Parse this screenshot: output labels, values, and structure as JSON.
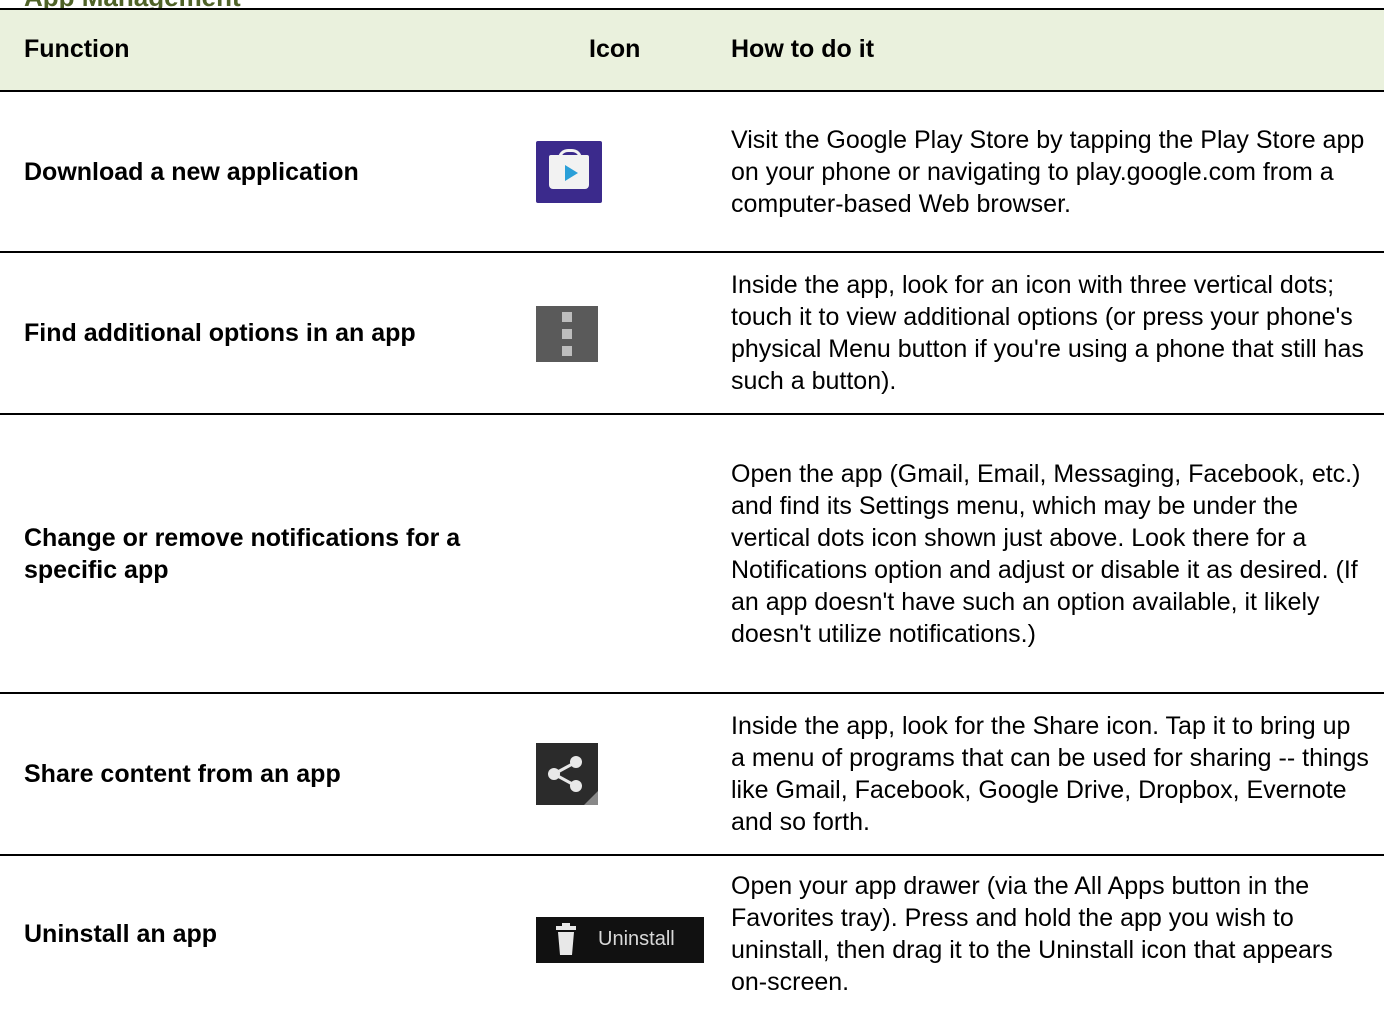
{
  "section_title": "App Management",
  "header": {
    "function": "Function",
    "icon": "Icon",
    "how": "How to do it"
  },
  "rows": [
    {
      "function": "Download a new application",
      "icon": "play-store-icon",
      "how": "Visit the Google Play Store by tapping the Play Store app on your phone or navigating to play.google.com from a computer-based Web browser."
    },
    {
      "function": "Find additional options in an app",
      "icon": "overflow-menu-icon",
      "how": "Inside the app, look for an icon with three vertical dots; touch it to view additional options (or press your phone's physical Menu button if you're using a phone that still has such a button)."
    },
    {
      "function": "Change or remove notifications for a specific app",
      "icon": "",
      "how": "Open the app (Gmail, Email, Messaging, Facebook, etc.) and find its Settings menu, which may be under the vertical dots icon shown just above. Look there for a Notifications option and adjust or disable it as desired. (If an app doesn't have such an option available, it likely doesn't utilize notifications.)"
    },
    {
      "function": "Share content from an app",
      "icon": "share-icon",
      "how": "Inside the app, look for the Share icon. Tap it to bring up a menu of programs that can be used for sharing -- things like Gmail, Facebook, Google Drive, Dropbox, Evernote and so forth."
    },
    {
      "function": "Uninstall an app",
      "icon": "uninstall-icon",
      "icon_label": "Uninstall",
      "how": "Open your app drawer (via the All Apps button in the Favorites tray). Press and hold the app you wish to uninstall, then drag it to the Uninstall icon that appears on-screen."
    }
  ],
  "colors": {
    "header_bg": "#eaf1dd",
    "title_green": "#4f6228"
  }
}
